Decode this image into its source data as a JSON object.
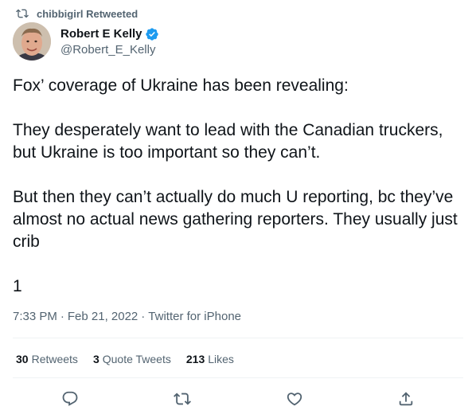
{
  "retweet": {
    "label": "chibbigirl Retweeted",
    "icon": "retweet-icon"
  },
  "author": {
    "name": "Robert E Kelly",
    "handle": "@Robert_E_Kelly",
    "verified": true,
    "verified_color": "#1d9bf0"
  },
  "tweet": {
    "paragraphs": [
      "Fox’ coverage of Ukraine has been revealing:",
      "They desperately want to lead with the Canadian truckers, but Ukraine is too important so they can’t.",
      "But then they can’t actually do much U reporting, bc they’ve almost no actual news gathering reporters. They usually just crib",
      "1"
    ]
  },
  "meta": {
    "time": "7:33 PM",
    "dot1": "·",
    "date": "Feb 21, 2022",
    "dot2": "·",
    "source": "Twitter for iPhone"
  },
  "stats": {
    "retweets": {
      "count": "30",
      "label": "Retweets"
    },
    "quotes": {
      "count": "3",
      "label": "Quote Tweets"
    },
    "likes": {
      "count": "213",
      "label": "Likes"
    }
  },
  "actions": [
    "reply-icon",
    "retweet-icon",
    "like-icon",
    "share-icon"
  ],
  "colors": {
    "text": "#0f1419",
    "secondary": "#536471",
    "divider": "#eff3f4",
    "accent": "#1d9bf0"
  }
}
